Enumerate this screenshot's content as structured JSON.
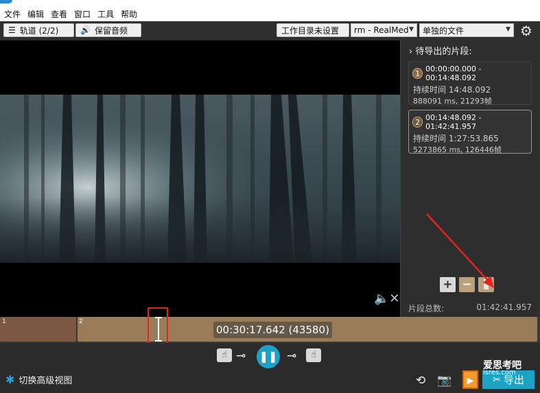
{
  "menu": [
    "文件",
    "编辑",
    "查看",
    "窗口",
    "工具",
    "帮助"
  ],
  "toolbar": {
    "tracks_label": "轨道 (2/2)",
    "audio_label": "保留音频",
    "workdir_label": "工作目录未设置",
    "format_value": "rm - RealMed",
    "output_mode_value": "单独的文件"
  },
  "sidebar": {
    "title": "待导出的片段:",
    "segments": [
      {
        "num": "1",
        "range": "00:00:00.000 - 00:14:48.092",
        "duration": "持续时间 14:48.092",
        "detail": "888091 ms, 21293帧"
      },
      {
        "num": "2",
        "range": "00:14:48.092 - 01:42:41.957",
        "duration": "持续时间 1:27:53.865",
        "detail": "5273865 ms, 126446帧"
      }
    ],
    "total_label": "片段总数:",
    "total_value": "01:42:41.957"
  },
  "timeline": {
    "segment1_label": "1",
    "segment2_label": "2",
    "current_time": "00:30:17.642 (43580)"
  },
  "bottom": {
    "advanced_view": "切换高级视图",
    "export_label": "导出",
    "watermark_main": "爱思考吧",
    "watermark_sub": "isres.com"
  },
  "colors": {
    "accent": "#1ba3c6",
    "segment1": "#7c5744",
    "segment2": "#9a7d58",
    "annotation_red": "#e0251f",
    "export_play": "#f39c2c"
  },
  "icons": [
    "menu-lines-icon",
    "speaker-icon",
    "gear-icon",
    "chevron-right-icon",
    "plus-icon",
    "minus-icon",
    "split-icon",
    "mute-icon",
    "hand-icon",
    "key-icon",
    "pause-icon",
    "person-icon",
    "rotate-icon",
    "camera-icon",
    "play-icon",
    "scissors-icon"
  ]
}
